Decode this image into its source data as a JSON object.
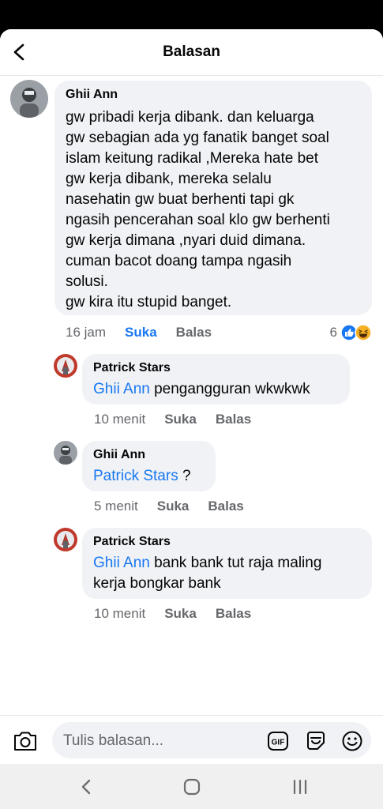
{
  "header": {
    "title": "Balasan"
  },
  "comments": [
    {
      "author": "Ghii Ann",
      "text": "gw pribadi kerja dibank. dan keluarga\ngw sebagian ada yg fanatik banget soal\nislam keitung radikal ,Mereka hate bet\ngw kerja dibank, mereka selalu\nnasehatin gw buat berhenti tapi gk\nngasih pencerahan soal klo gw berhenti\ngw kerja dimana ,nyari duid dimana.\ncuman bacot doang tampa ngasih\nsolusi.\ngw kira itu stupid banget.",
      "time": "16 jam",
      "like_label": "Suka",
      "reply_label": "Balas",
      "reaction_count": "6"
    },
    {
      "author": "Patrick Stars",
      "mention": "Ghii Ann",
      "text": " pengangguran wkwkwk",
      "time": "10 menit",
      "like_label": "Suka",
      "reply_label": "Balas"
    },
    {
      "author": "Ghii Ann",
      "mention": "Patrick Stars",
      "text": " ?",
      "time": "5 menit",
      "like_label": "Suka",
      "reply_label": "Balas"
    },
    {
      "author": "Patrick Stars",
      "mention": "Ghii Ann",
      "text": " bank bank tut raja maling\nkerja bongkar bank",
      "time": "10 menit",
      "like_label": "Suka",
      "reply_label": "Balas"
    }
  ],
  "composer": {
    "placeholder": "Tulis balasan..."
  },
  "colors": {
    "accent": "#1877f2",
    "bubble": "#f0f2f5",
    "muted": "#65676b"
  }
}
